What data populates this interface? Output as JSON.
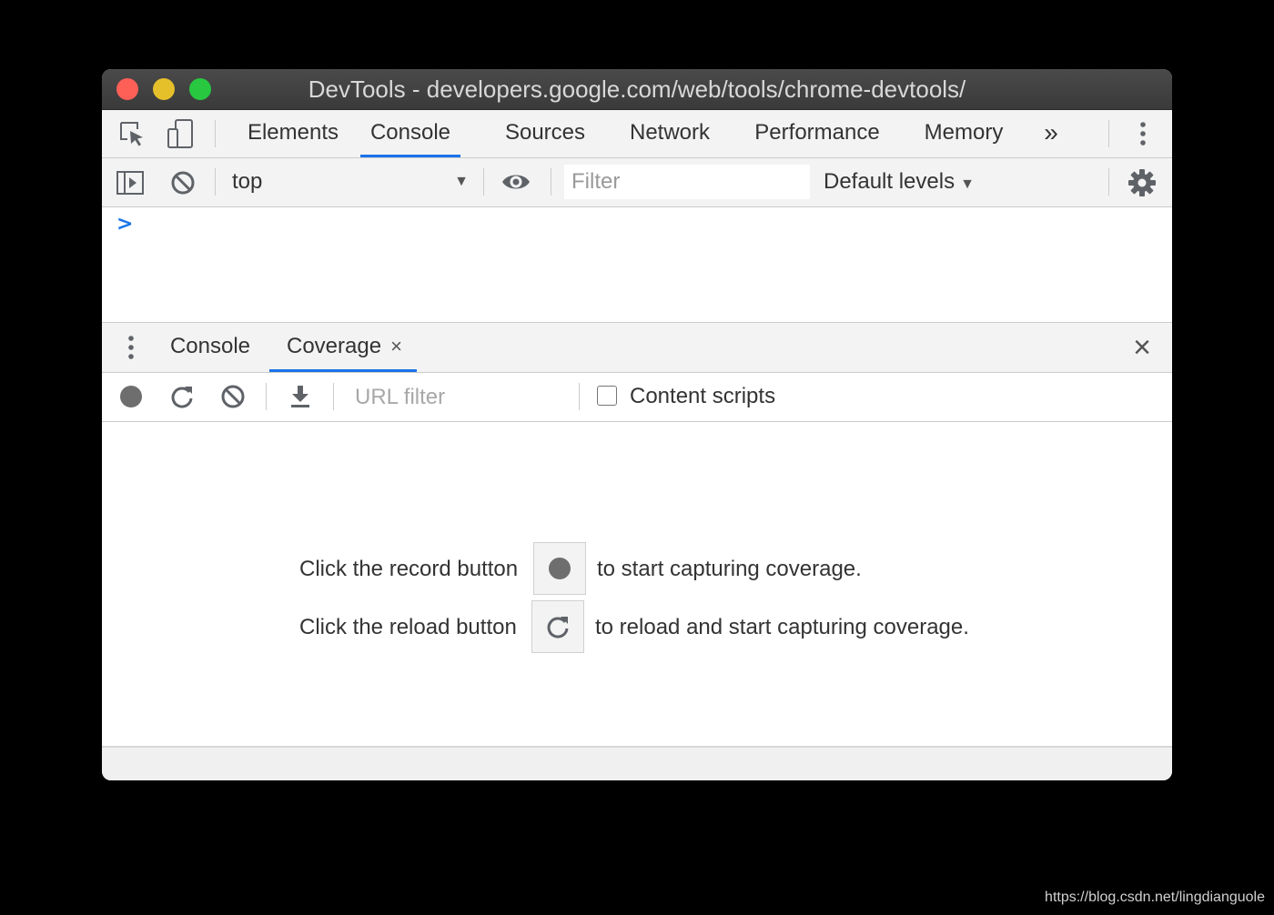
{
  "window": {
    "title": "DevTools - developers.google.com/web/tools/chrome-devtools/"
  },
  "main_toolbar": {
    "tabs": [
      {
        "label": "Elements",
        "active": false
      },
      {
        "label": "Console",
        "active": true
      },
      {
        "label": "Sources",
        "active": false
      },
      {
        "label": "Network",
        "active": false
      },
      {
        "label": "Performance",
        "active": false
      },
      {
        "label": "Memory",
        "active": false
      }
    ],
    "more_tabs_glyph": "»",
    "icons": [
      "inspect-element-icon",
      "device-toolbar-icon",
      "more-tabs-icon",
      "kebab-menu-icon"
    ]
  },
  "console_toolbar": {
    "context": "top",
    "filter_placeholder": "Filter",
    "levels": "Default levels",
    "icons": [
      "sidebar-toggle-icon",
      "clear-console-icon",
      "eye-icon",
      "gear-icon"
    ]
  },
  "console": {
    "prompt": ">"
  },
  "drawer": {
    "tabs": [
      {
        "label": "Console",
        "active": false
      },
      {
        "label": "Coverage",
        "active": true,
        "closable": true
      }
    ],
    "tab_close_glyph": "×",
    "close_glyph": "×"
  },
  "coverage_toolbar": {
    "url_filter_placeholder": "URL filter",
    "content_scripts_label": "Content scripts",
    "content_scripts_checked": false,
    "icons": [
      "record-icon",
      "reload-icon",
      "clear-icon",
      "download-icon"
    ]
  },
  "coverage": {
    "line1_before": "Click the record button",
    "line1_after": "to start capturing coverage.",
    "line2_before": "Click the reload button",
    "line2_after": "to reload and start capturing coverage."
  },
  "watermark": "https://blog.csdn.net/lingdianguole",
  "colors": {
    "accent": "#1a73e8",
    "toolbar_bg": "#f3f3f3",
    "titlebar_bg": "#3d3d3d",
    "traffic_red": "#fe5f57",
    "traffic_yellow": "#e6c02b",
    "traffic_green": "#28c840"
  }
}
